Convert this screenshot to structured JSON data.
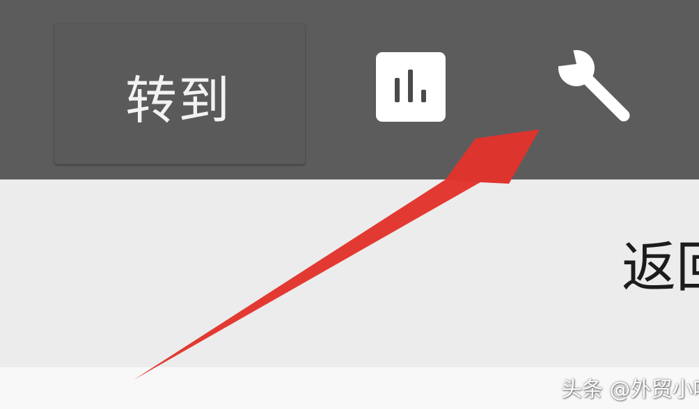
{
  "toolbar": {
    "goto_label": "转到",
    "stats_icon": "bar-chart-icon",
    "settings_icon": "wrench-icon"
  },
  "content": {
    "back_label": "返回"
  },
  "annotation": {
    "arrow_color": "#e23a32"
  },
  "watermark": {
    "text": "头条 @外贸小叶"
  },
  "colors": {
    "toolbar_bg": "#5c5c5d",
    "content_bg": "#ececec",
    "icon_fg": "#ffffff"
  }
}
